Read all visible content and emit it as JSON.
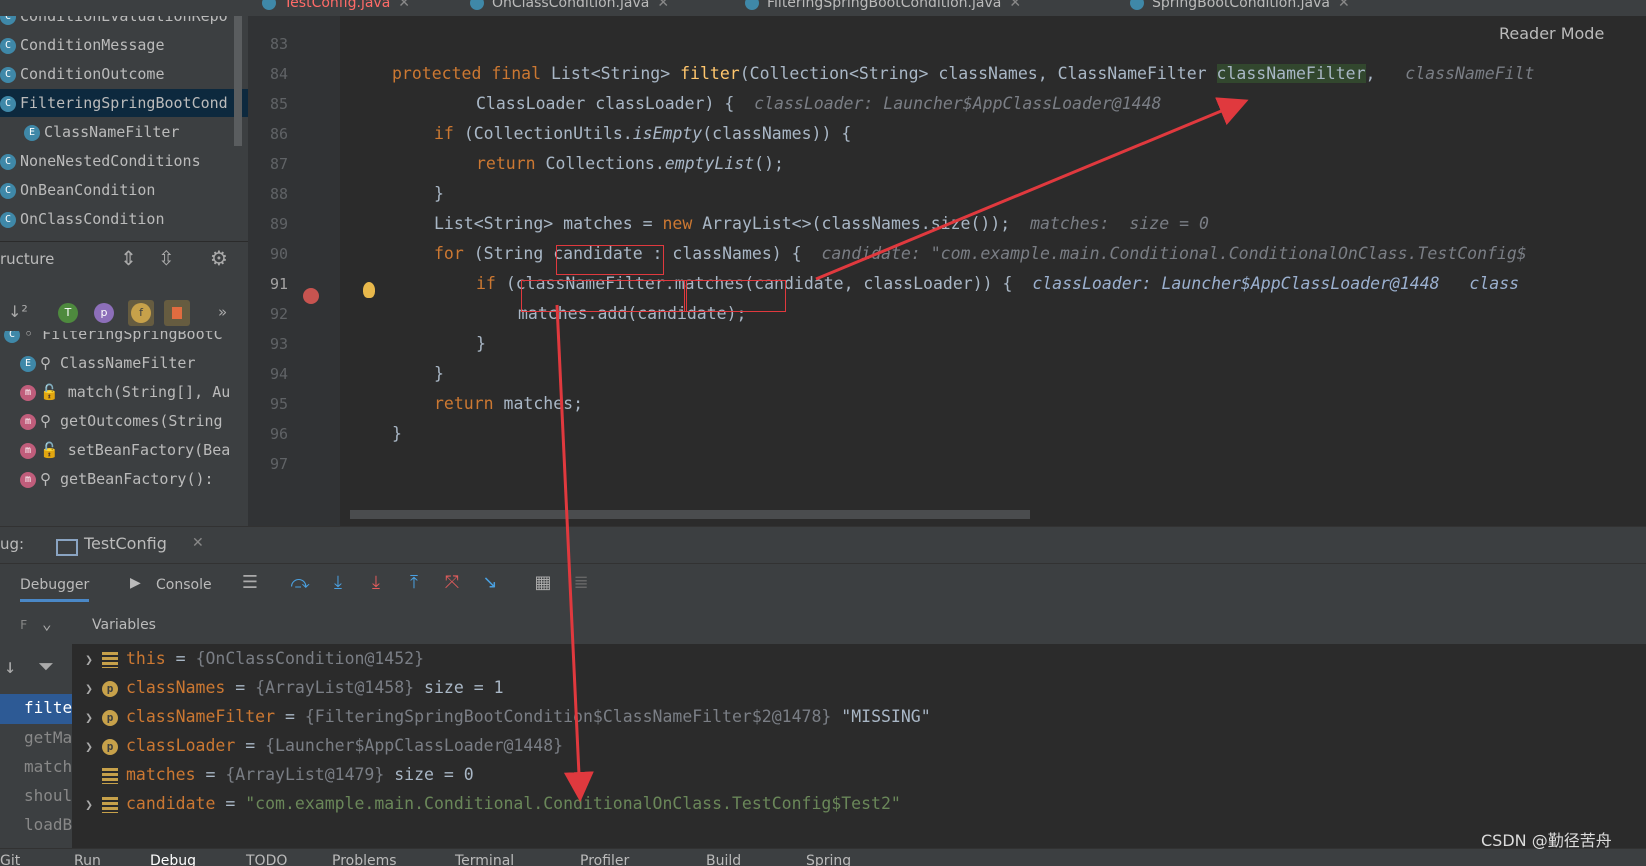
{
  "tabs": [
    {
      "label": "TestConfig.java",
      "active": true
    },
    {
      "label": "OnClassCondition.java",
      "active": false
    },
    {
      "label": "FilteringSpringBootCondition.java",
      "active": false
    },
    {
      "label": "SpringBootCondition.java",
      "active": false
    }
  ],
  "project_tree": [
    {
      "label": "ConditionEvaluationRepo",
      "selected": false
    },
    {
      "label": "ConditionMessage",
      "selected": false
    },
    {
      "label": "ConditionOutcome",
      "selected": false
    },
    {
      "label": "FilteringSpringBootCond",
      "selected": true
    },
    {
      "label": "ClassNameFilter",
      "selected": false
    },
    {
      "label": "NoneNestedConditions",
      "selected": false
    },
    {
      "label": "OnBeanCondition",
      "selected": false
    },
    {
      "label": "OnClassCondition",
      "selected": false
    }
  ],
  "structure": {
    "title": "ructure",
    "items": [
      "FilteringSpringBootC",
      "ClassNameFilter",
      "match(String[], Au",
      "getOutcomes(String",
      "setBeanFactory(Bea",
      "getBeanFactory():"
    ]
  },
  "editor": {
    "reader_mode": "Reader Mode",
    "line_numbers": [
      "83",
      "84",
      "85",
      "86",
      "87",
      "88",
      "89",
      "90",
      "91",
      "92",
      "93",
      "94",
      "95",
      "96",
      "97"
    ],
    "current_line": "91",
    "hints": {
      "classNameFilter_tail": "classNameFilt",
      "classLoader": "classLoader: Launcher$AppClassLoader@1448",
      "matches": "matches:  size = 0",
      "candidate": "candidate: \"com.example.main.Conditional.ConditionalOnClass.TestConfig$",
      "line91_loader": "classLoader: Launcher$AppClassLoader@1448",
      "line91_tail": "class"
    }
  },
  "debug": {
    "label": "ug:",
    "session": "TestConfig",
    "tabs": [
      "Debugger",
      "Console"
    ],
    "frames_label": "F",
    "frames": [
      "filte",
      "getMa",
      "match",
      "shoul",
      "loadB"
    ],
    "variables_title": "Variables",
    "variables": [
      {
        "name": "this",
        "value": "{OnClassCondition@1452}",
        "extra": ""
      },
      {
        "name": "classNames",
        "value": "{ArrayList@1458}",
        "extra": "size = 1"
      },
      {
        "name": "classNameFilter",
        "value": "{FilteringSpringBootCondition$ClassNameFilter$2@1478}",
        "extra": "\"MISSING\""
      },
      {
        "name": "classLoader",
        "value": "{Launcher$AppClassLoader@1448}",
        "extra": ""
      },
      {
        "name": "matches",
        "value": "{ArrayList@1479}",
        "extra": "size = 0"
      },
      {
        "name": "candidate",
        "value": "\"com.example.main.Conditional.ConditionalOnClass.TestConfig$Test2\"",
        "extra": ""
      }
    ]
  },
  "bottom_tabs": [
    "Git",
    "Run",
    "Debug",
    "TODO",
    "Problems",
    "Terminal",
    "Profiler",
    "Build",
    "Spring"
  ],
  "watermark": "CSDN @勤径苦舟",
  "colors": {
    "keyword": "#cc7832",
    "method": "#ffc66d",
    "highlight": "#2d5a95",
    "annotation": "#e0393e"
  }
}
